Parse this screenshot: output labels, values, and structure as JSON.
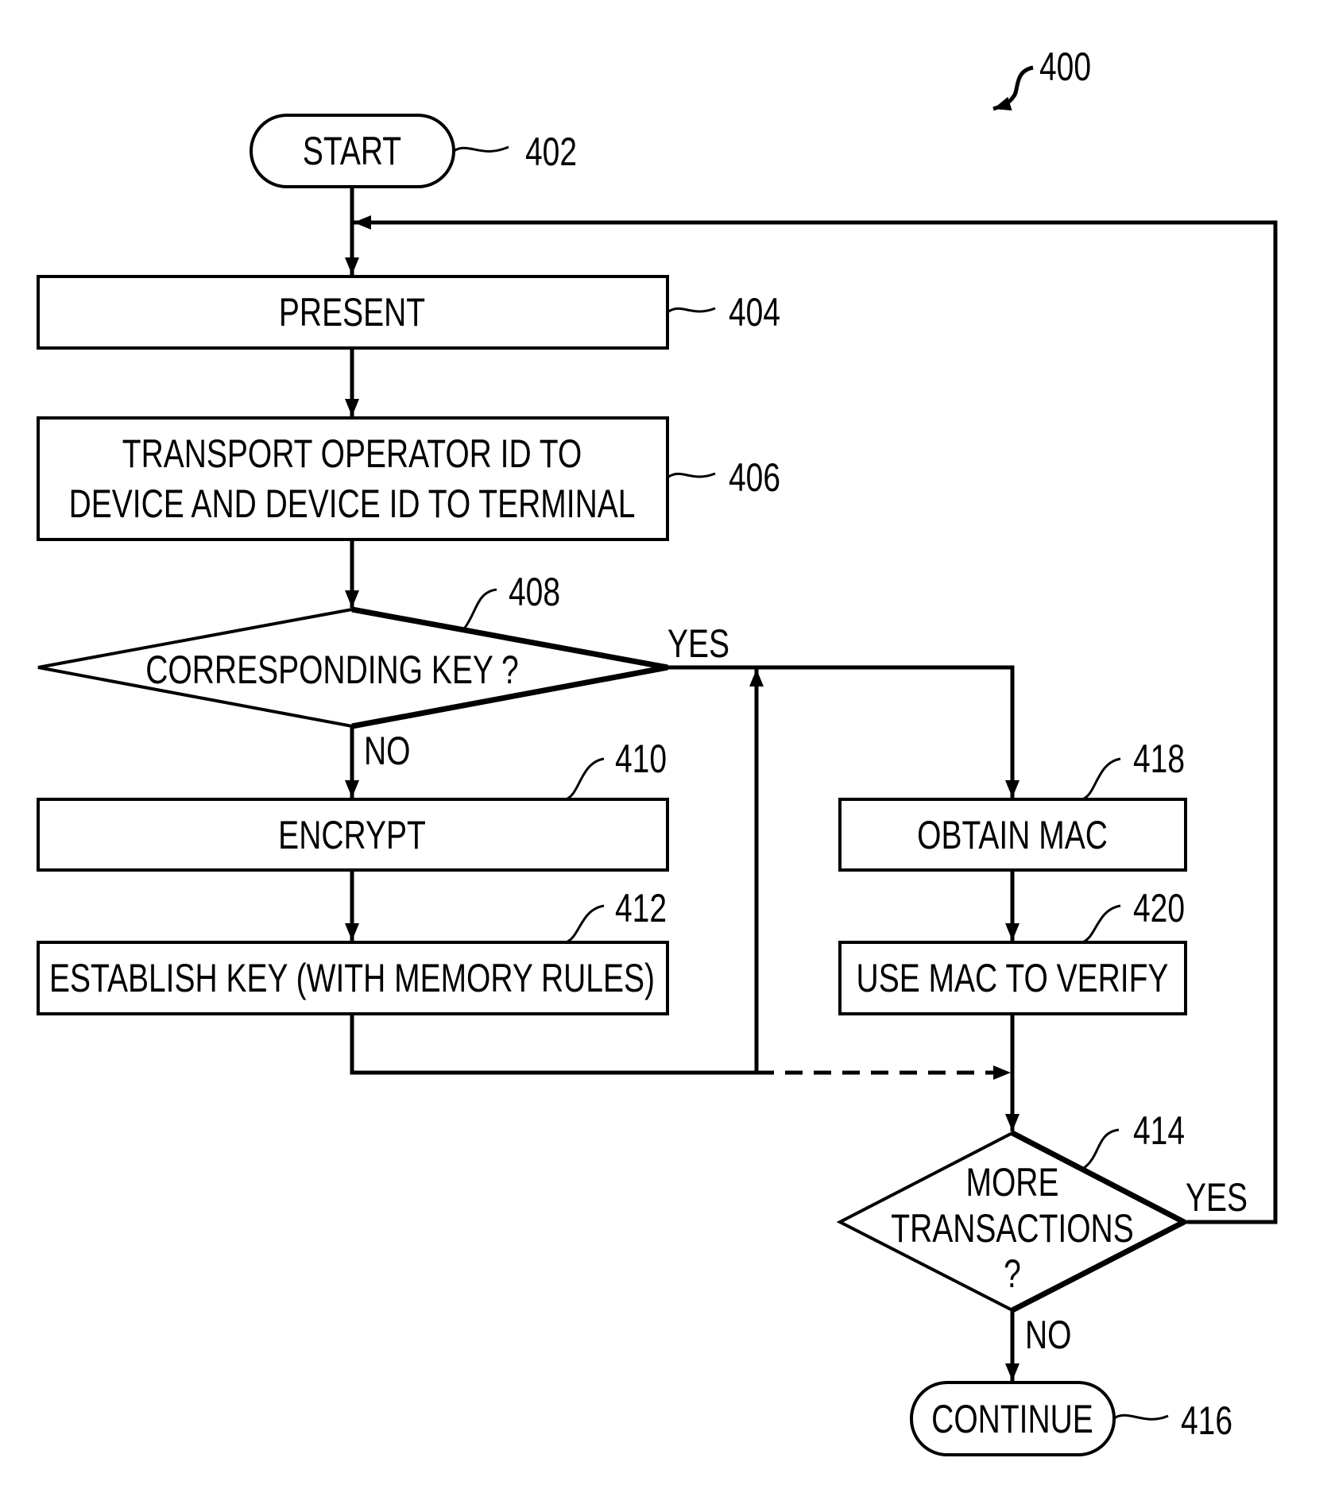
{
  "figure": {
    "number": "400",
    "colors": {
      "ink": "#000000",
      "background": "#ffffff"
    }
  },
  "nodes": {
    "start": {
      "ref": "402",
      "lines": [
        "START"
      ]
    },
    "present": {
      "ref": "404",
      "lines": [
        "PRESENT"
      ]
    },
    "transport": {
      "ref": "406",
      "lines": [
        "TRANSPORT OPERATOR ID TO",
        "DEVICE AND DEVICE ID TO TERMINAL"
      ]
    },
    "key_decision": {
      "ref": "408",
      "lines": [
        "CORRESPONDING KEY ?"
      ],
      "yes": "YES",
      "no": "NO"
    },
    "encrypt": {
      "ref": "410",
      "lines": [
        "ENCRYPT"
      ]
    },
    "establish": {
      "ref": "412",
      "lines": [
        "ESTABLISH KEY (WITH MEMORY RULES)"
      ]
    },
    "more_decision": {
      "ref": "414",
      "lines": [
        "MORE",
        "TRANSACTIONS",
        "?"
      ],
      "yes": "YES",
      "no": "NO"
    },
    "continue": {
      "ref": "416",
      "lines": [
        "CONTINUE"
      ]
    },
    "obtain_mac": {
      "ref": "418",
      "lines": [
        "OBTAIN MAC"
      ]
    },
    "use_mac": {
      "ref": "420",
      "lines": [
        "USE MAC TO VERIFY"
      ]
    }
  }
}
